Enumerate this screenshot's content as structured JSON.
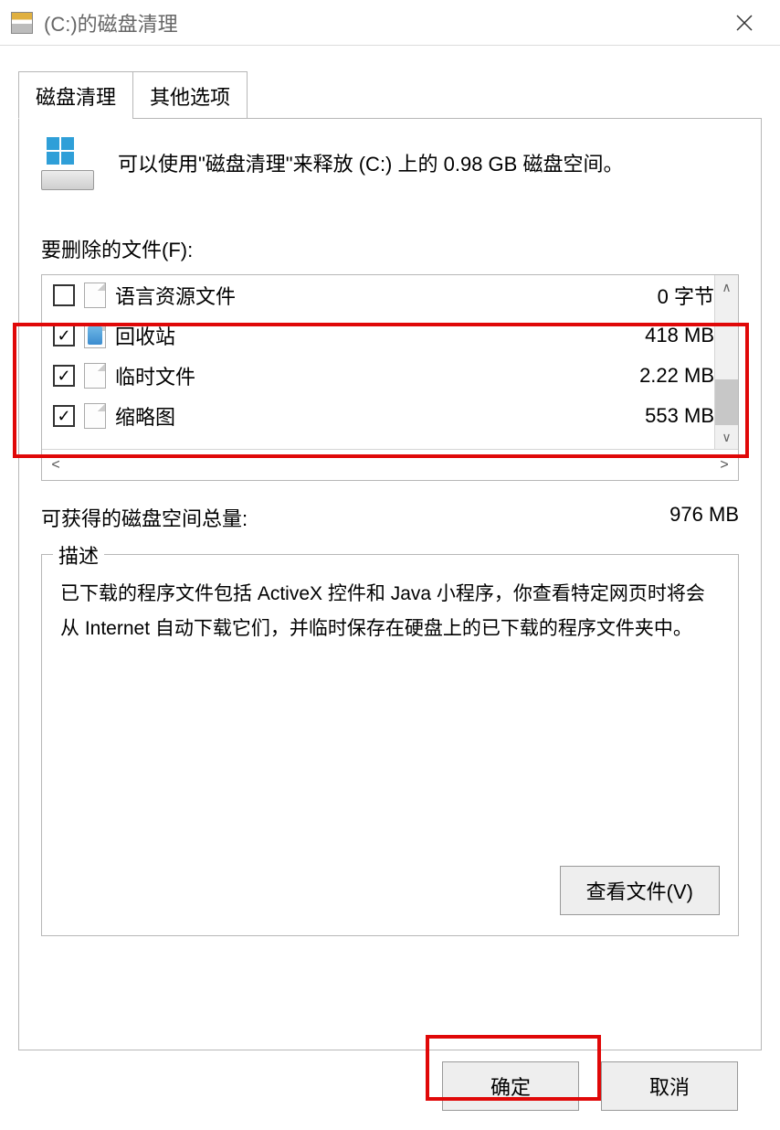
{
  "titlebar": {
    "title": "(C:)的磁盘清理"
  },
  "tabs": {
    "disk_cleanup": "磁盘清理",
    "other_options": "其他选项"
  },
  "info": {
    "text": "可以使用\"磁盘清理\"来释放  (C:) 上的 0.98 GB 磁盘空间。"
  },
  "files_section_label": "要删除的文件(F):",
  "file_rows": [
    {
      "checked": false,
      "icon": "file",
      "label": "语言资源文件",
      "size": "0 字节"
    },
    {
      "checked": true,
      "icon": "bin",
      "label": "回收站",
      "size": "418 MB"
    },
    {
      "checked": true,
      "icon": "file",
      "label": "临时文件",
      "size": "2.22 MB"
    },
    {
      "checked": true,
      "icon": "file",
      "label": "缩略图",
      "size": "553 MB"
    }
  ],
  "total": {
    "label": "可获得的磁盘空间总量:",
    "value": "976 MB"
  },
  "description": {
    "legend": "描述",
    "text": "已下载的程序文件包括 ActiveX 控件和 Java 小程序，你查看特定网页时将会从 Internet 自动下载它们，并临时保存在硬盘上的已下载的程序文件夹中。",
    "view_files_btn": "查看文件(V)"
  },
  "buttons": {
    "ok": "确定",
    "cancel": "取消"
  }
}
